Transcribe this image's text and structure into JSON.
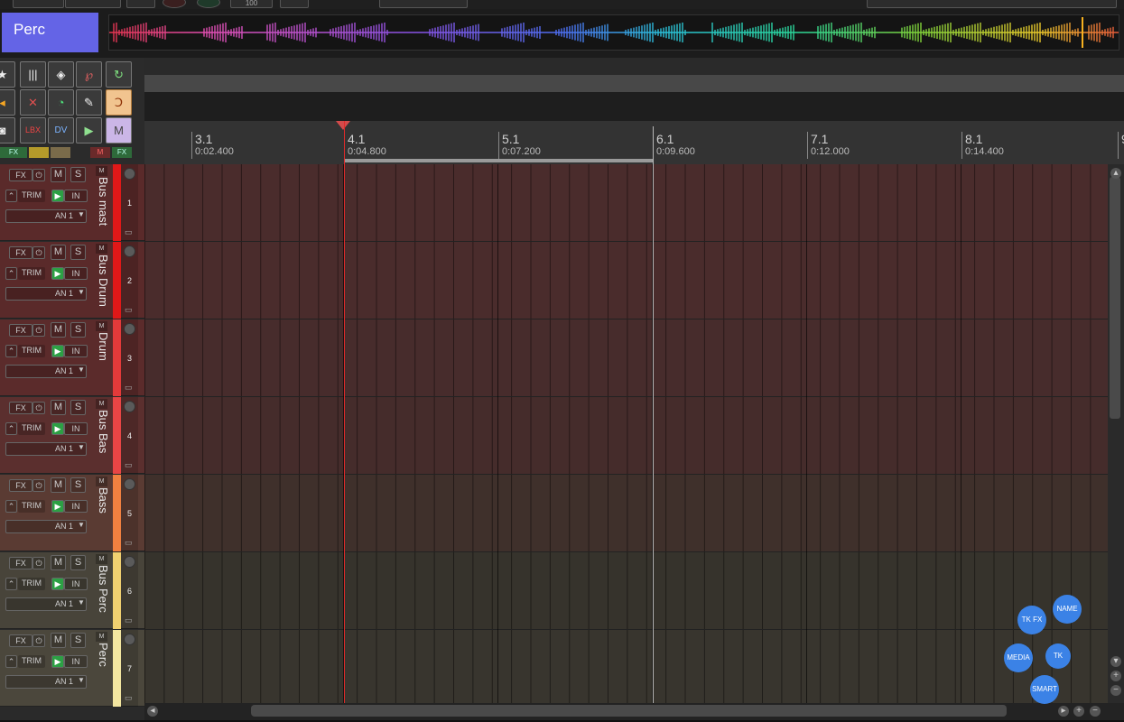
{
  "header": {
    "track_name": "Perc",
    "topstrip_value": "100"
  },
  "toolbar": {
    "row1": [
      "star-icon",
      "grid-icon",
      "shield-icon",
      "loop-icon",
      "check-loop-icon"
    ],
    "row2": [
      "dot-left-icon",
      "dot-x-icon",
      "circle-dot-icon",
      "pen-icon",
      "snap-icon"
    ],
    "row3": [
      "disk-icon",
      "LBX",
      "DV",
      "play-box-icon",
      "M"
    ],
    "mini": [
      "FX",
      "FX",
      "M",
      "FX"
    ]
  },
  "ruler": {
    "markers": [
      {
        "measure": "3.1",
        "time": "0:02.400"
      },
      {
        "measure": "4.1",
        "time": "0:04.800"
      },
      {
        "measure": "5.1",
        "time": "0:07.200"
      },
      {
        "measure": "6.1",
        "time": "0:09.600"
      },
      {
        "measure": "7.1",
        "time": "0:12.000"
      },
      {
        "measure": "8.1",
        "time": "0:14.400"
      },
      {
        "measure": "9",
        "time": ""
      }
    ]
  },
  "track_controls": {
    "fx": "FX",
    "mute": "M",
    "solo": "S",
    "trim": "TRIM",
    "input": "IN",
    "io": "AN 1"
  },
  "tracks": [
    {
      "name": "Bus mast",
      "number": "1",
      "color": "#e01818",
      "lane": "#4a2c2c",
      "tcp": "#5a2a2a"
    },
    {
      "name": "Bus Drum",
      "number": "2",
      "color": "#e01818",
      "lane": "#4a2c2c",
      "tcp": "#5a2a2a"
    },
    {
      "name": "Drum",
      "number": "3",
      "color": "#e33a3a",
      "lane": "#472c2c",
      "tcp": "#5b2b2b"
    },
    {
      "name": "Bus Bas",
      "number": "4",
      "color": "#e84545",
      "lane": "#452c2b",
      "tcp": "#5b2f2e"
    },
    {
      "name": "Bass",
      "number": "5",
      "color": "#f08040",
      "lane": "#3f302b",
      "tcp": "#5a3b33"
    },
    {
      "name": "Bus Perc",
      "number": "6",
      "color": "#f0d070",
      "lane": "#36332c",
      "tcp": "#48443a"
    },
    {
      "name": "Perc",
      "number": "7",
      "color": "#f3e6a0",
      "lane": "#38352e",
      "tcp": "#4b473c"
    }
  ],
  "bubbles": [
    "NAME",
    "TK FX",
    "MEDIA",
    "TK",
    "SMART"
  ],
  "colors": {
    "accent": "#6464e6",
    "playhead": "#e02a2a",
    "bubble": "#3b82e6"
  }
}
